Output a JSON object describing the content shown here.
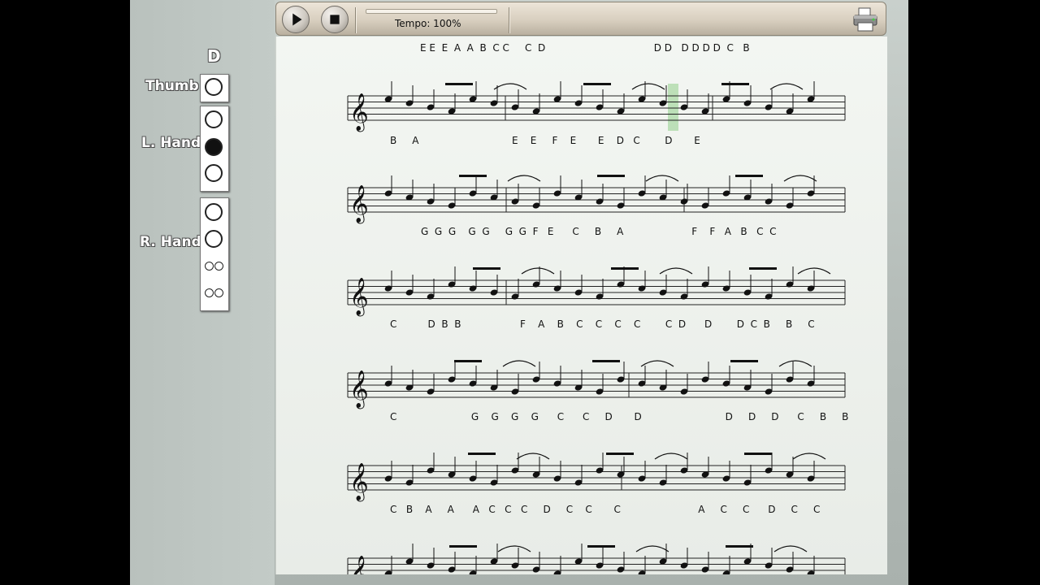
{
  "fingering": {
    "current_note": "D",
    "thumb_label": "Thumb",
    "left_hand_label": "L. Hand",
    "right_hand_label": "R. Hand",
    "thumb_holes": [
      "open"
    ],
    "left_hand_holes": [
      "open",
      "closed",
      "open"
    ],
    "right_hand_holes": [
      "open",
      "open",
      "open-double",
      "open-double"
    ]
  },
  "toolbar": {
    "play_icon": "play-icon",
    "stop_icon": "stop-icon",
    "tempo_label": "Tempo: 100%",
    "tempo_percent": 100,
    "printer_icon": "printer-icon"
  },
  "sheet": {
    "header_notes": "E E  E  A  A  B  C C     C  D                                   D D   D D D D  C   B",
    "systems": [
      {
        "lyrics": "B     A                              E    E     F    E       E    D   C        D       E"
      },
      {
        "lyrics": "G  G  G    G  G     G  G  F   E      C     B     A                      F    F   A   B   C  C"
      },
      {
        "lyrics": "C          D  B  B                   F    A    B    C    C    C    C        C  D      D        D  C  B     B     C"
      },
      {
        "lyrics": "C                        G    G    G    G      C      C     D       D                           D     D     D      C     B     B"
      },
      {
        "lyrics": "C   B    A     A      A   C   C   C     D     C    C       C                         A     C     C      D     C     C"
      }
    ]
  }
}
